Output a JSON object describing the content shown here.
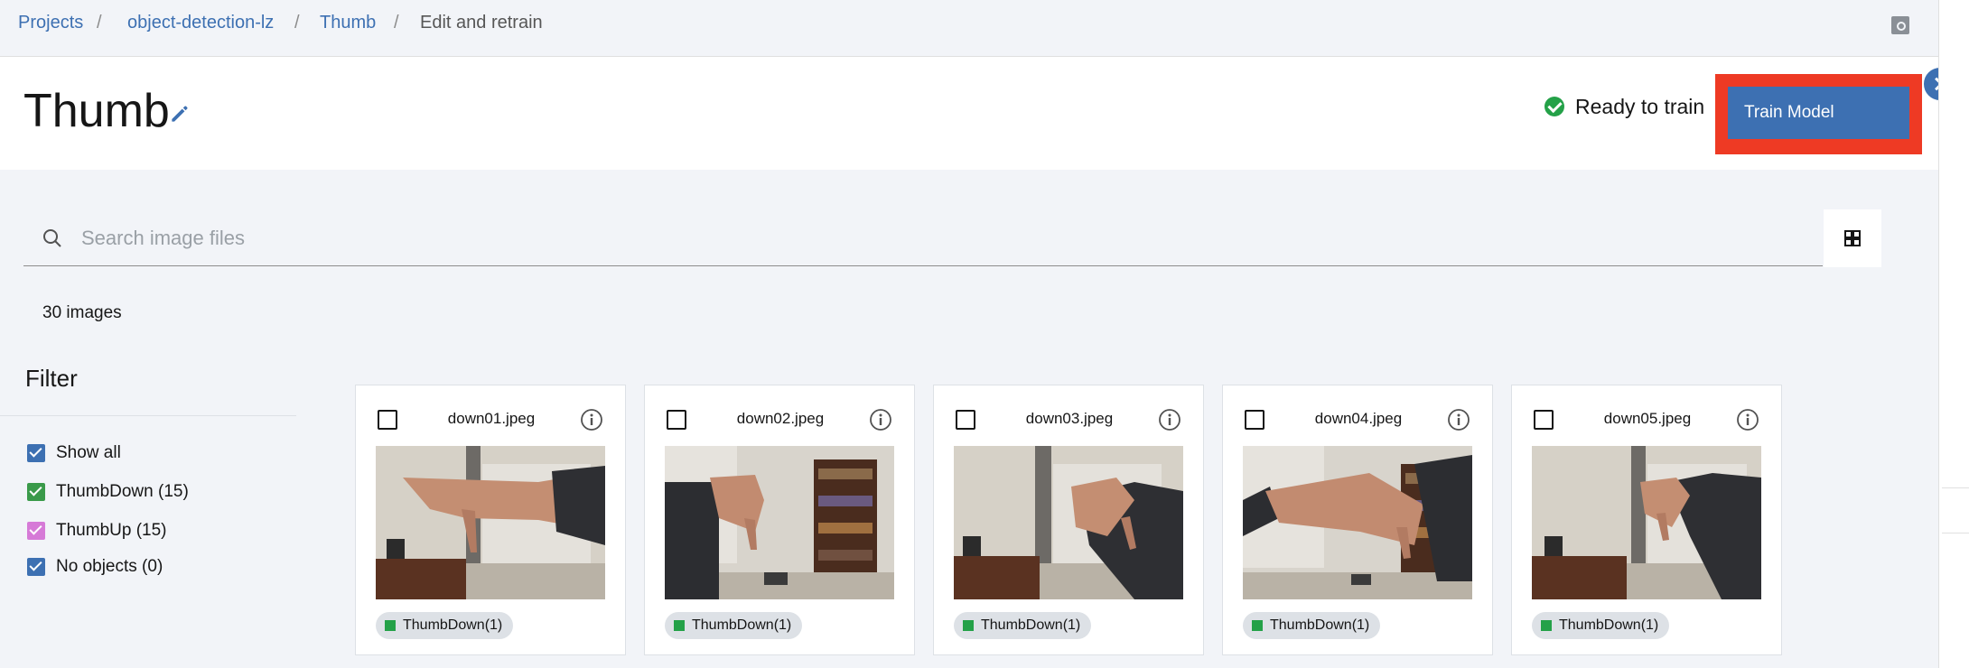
{
  "breadcrumb": {
    "items": [
      "Projects",
      "object-detection-lz",
      "Thumb",
      "Edit and retrain"
    ],
    "separator": "/"
  },
  "header": {
    "title": "Thumb",
    "status": "Ready to train",
    "train_button": "Train Model"
  },
  "search": {
    "placeholder": "Search image files",
    "value": ""
  },
  "image_count": "30 images",
  "filter": {
    "title": "Filter",
    "items": [
      {
        "label": "Show all",
        "color": "#3d70b2",
        "checked": true
      },
      {
        "label": "ThumbDown (15)",
        "color": "#3a9a4a",
        "checked": true
      },
      {
        "label": "ThumbUp (15)",
        "color": "#d67ad7",
        "checked": true
      },
      {
        "label": "No objects (0)",
        "color": "#3d70b2",
        "checked": true
      }
    ]
  },
  "images": [
    {
      "name": "down01.jpeg",
      "tag": "ThumbDown(1)"
    },
    {
      "name": "down02.jpeg",
      "tag": "ThumbDown(1)"
    },
    {
      "name": "down03.jpeg",
      "tag": "ThumbDown(1)"
    },
    {
      "name": "down04.jpeg",
      "tag": "ThumbDown(1)"
    },
    {
      "name": "down05.jpeg",
      "tag": "ThumbDown(1)"
    }
  ],
  "colors": {
    "accent": "#3d70b2",
    "highlight": "#ee3a24",
    "success": "#24a148",
    "tag_thumbdown": "#24a148"
  }
}
